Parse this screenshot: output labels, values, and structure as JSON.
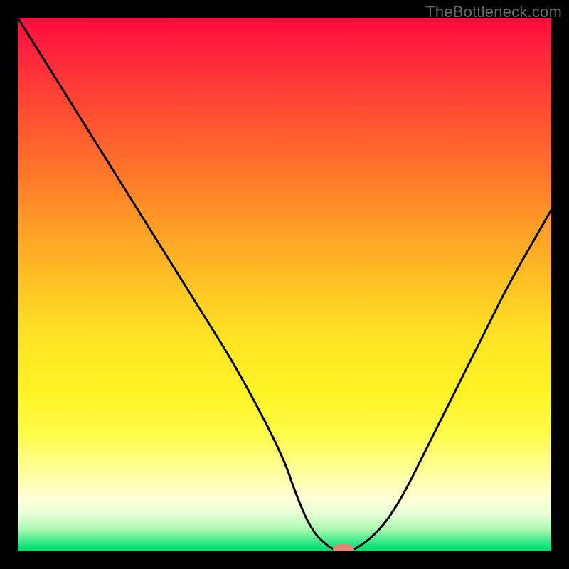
{
  "watermark": "TheBottleneck.com",
  "colors": {
    "page_bg": "#000000",
    "watermark": "#6b6b6b",
    "curve_stroke": "#000000",
    "marker_fill": "#dd8a7c"
  },
  "chart_data": {
    "type": "line",
    "title": "",
    "xlabel": "",
    "ylabel": "",
    "xlim": [
      0,
      100
    ],
    "ylim": [
      0,
      100
    ],
    "grid": false,
    "gradient_stops": [
      {
        "pct": 0,
        "color": "#ff0b3e"
      },
      {
        "pct": 8,
        "color": "#ff2a3a"
      },
      {
        "pct": 20,
        "color": "#ff5530"
      },
      {
        "pct": 30,
        "color": "#ff7a2a"
      },
      {
        "pct": 40,
        "color": "#ffa026"
      },
      {
        "pct": 50,
        "color": "#ffc324"
      },
      {
        "pct": 60,
        "color": "#ffe324"
      },
      {
        "pct": 70,
        "color": "#fff324"
      },
      {
        "pct": 78,
        "color": "#fffb4a"
      },
      {
        "pct": 84,
        "color": "#ffff90"
      },
      {
        "pct": 90,
        "color": "#ffffd6"
      },
      {
        "pct": 93,
        "color": "#e8ffd6"
      },
      {
        "pct": 96,
        "color": "#a8f8b0"
      },
      {
        "pct": 99,
        "color": "#12e47a"
      },
      {
        "pct": 100,
        "color": "#00d86a"
      }
    ],
    "series": [
      {
        "name": "bottleneck-curve",
        "x": [
          0,
          5,
          10,
          15,
          20,
          25,
          30,
          35,
          40,
          45,
          50,
          52,
          55,
          58,
          60,
          63,
          68,
          72,
          76,
          80,
          84,
          88,
          92,
          96,
          100
        ],
        "y": [
          100,
          92,
          84,
          76,
          68,
          60,
          52,
          44,
          36,
          27,
          17,
          11,
          4,
          1,
          0,
          0,
          4,
          10,
          18,
          26,
          34,
          42,
          50,
          57,
          64
        ]
      }
    ],
    "optimal_marker": {
      "x": 61,
      "y": 0
    }
  }
}
